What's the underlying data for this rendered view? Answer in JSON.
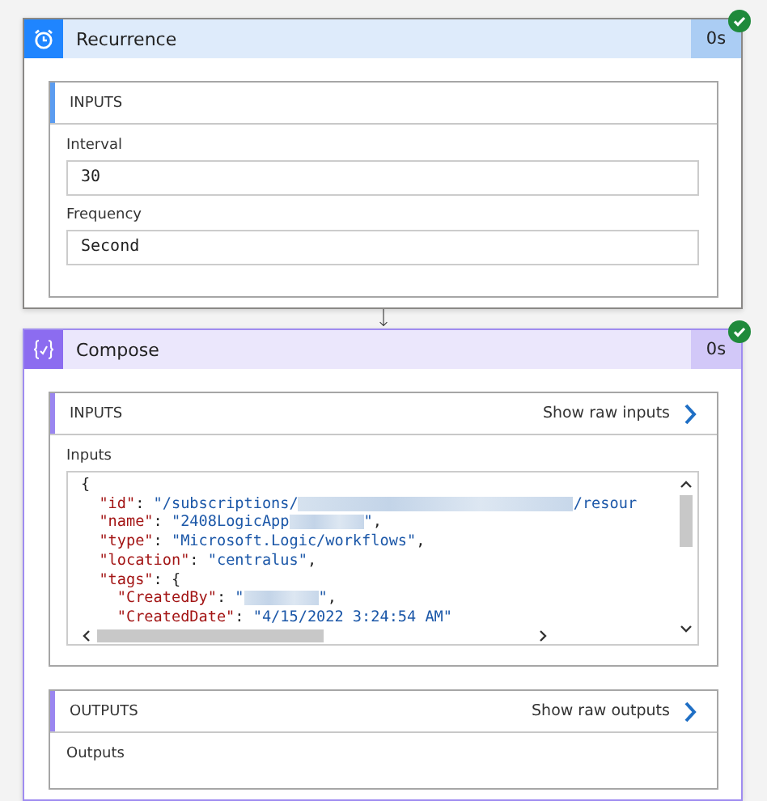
{
  "cards": [
    {
      "kind": "schedule",
      "title": "Recurrence",
      "duration": "0s",
      "succeeded": true,
      "sections": [
        {
          "title": "INPUTS",
          "fields": [
            {
              "label": "Interval",
              "value": "30"
            },
            {
              "label": "Frequency",
              "value": "Second"
            }
          ]
        }
      ]
    },
    {
      "kind": "compose",
      "title": "Compose",
      "duration": "0s",
      "succeeded": true,
      "sections": [
        {
          "title": "INPUTS",
          "link": "Show raw inputs",
          "code_label": "Inputs",
          "code": [
            [
              {
                "kind": "punct",
                "text": "{"
              }
            ],
            [
              {
                "kind": "key",
                "text": "  \"id\""
              },
              {
                "kind": "punct",
                "text": ": "
              },
              {
                "kind": "string",
                "text": "\"/subscriptions/"
              },
              {
                "kind": "redacted-long"
              },
              {
                "kind": "string",
                "text": "/resour"
              }
            ],
            [
              {
                "kind": "key",
                "text": "  \"name\""
              },
              {
                "kind": "punct",
                "text": ": "
              },
              {
                "kind": "string",
                "text": "\"2408LogicApp"
              },
              {
                "kind": "redacted-short"
              },
              {
                "kind": "string",
                "text": "\""
              },
              {
                "kind": "punct",
                "text": ","
              }
            ],
            [
              {
                "kind": "key",
                "text": "  \"type\""
              },
              {
                "kind": "punct",
                "text": ": "
              },
              {
                "kind": "string",
                "text": "\"Microsoft.Logic/workflows\""
              },
              {
                "kind": "punct",
                "text": ","
              }
            ],
            [
              {
                "kind": "key",
                "text": "  \"location\""
              },
              {
                "kind": "punct",
                "text": ": "
              },
              {
                "kind": "string",
                "text": "\"centralus\""
              },
              {
                "kind": "punct",
                "text": ","
              }
            ],
            [
              {
                "kind": "key",
                "text": "  \"tags\""
              },
              {
                "kind": "punct",
                "text": ": {"
              }
            ],
            [
              {
                "kind": "key",
                "text": "    \"CreatedBy\""
              },
              {
                "kind": "punct",
                "text": ": "
              },
              {
                "kind": "string",
                "text": "\""
              },
              {
                "kind": "redacted-short"
              },
              {
                "kind": "string",
                "text": "\""
              },
              {
                "kind": "punct",
                "text": ","
              }
            ],
            [
              {
                "kind": "key",
                "text": "    \"CreatedDate\""
              },
              {
                "kind": "punct",
                "text": ": "
              },
              {
                "kind": "string",
                "text": "\"4/15/2022 3:24:54 AM\""
              }
            ]
          ]
        },
        {
          "title": "OUTPUTS",
          "link": "Show raw outputs",
          "code_label": "Outputs"
        }
      ]
    }
  ]
}
